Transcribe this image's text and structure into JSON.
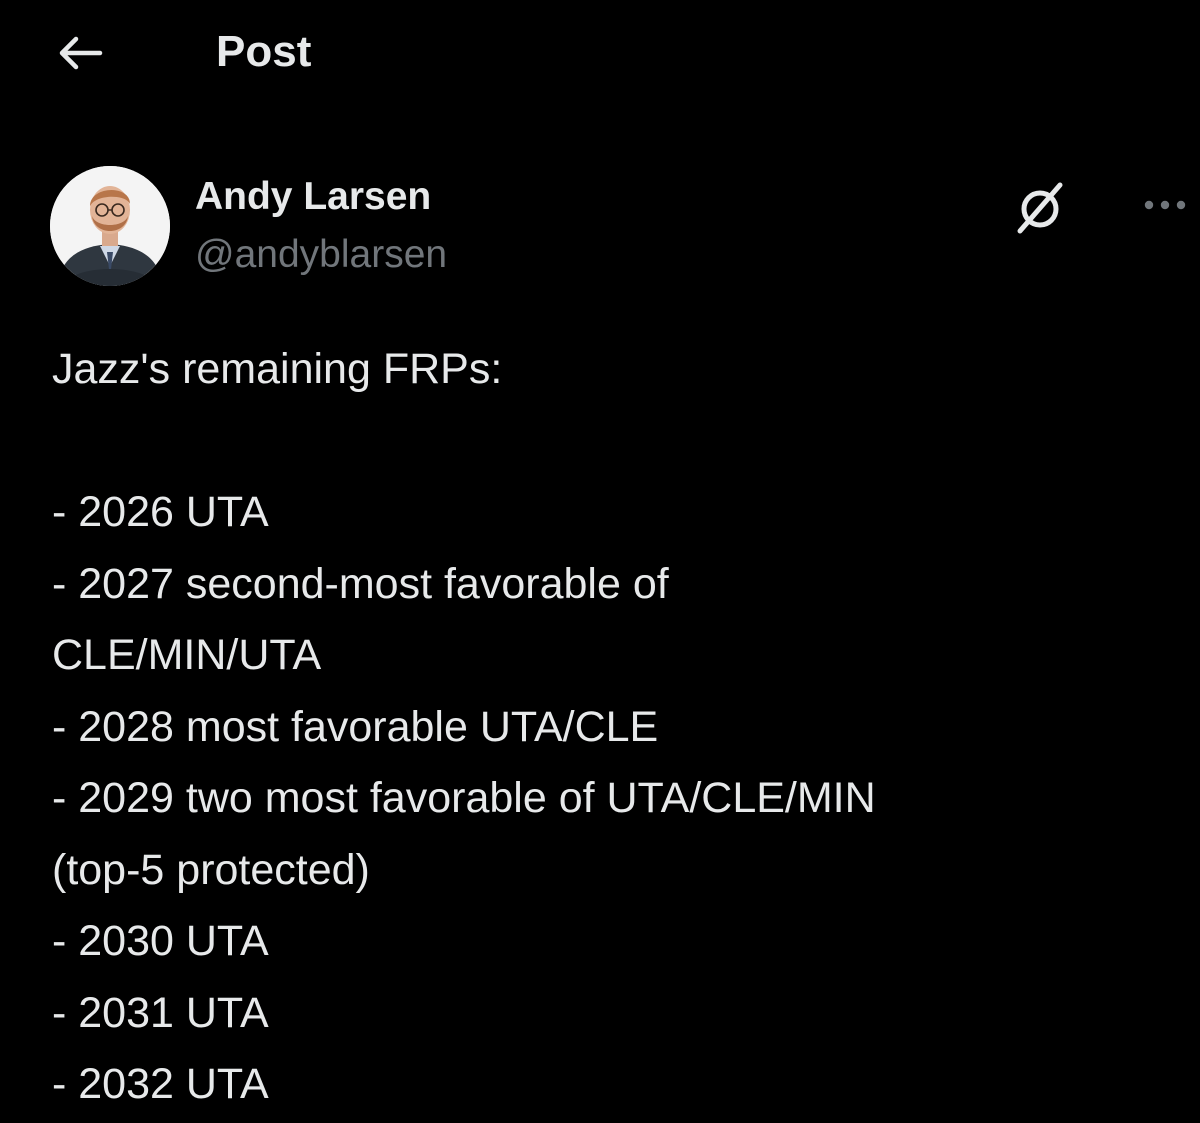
{
  "header": {
    "title": "Post",
    "back_icon": "arrow-left-icon"
  },
  "author": {
    "display_name": "Andy Larsen",
    "handle": "@andyblarsen",
    "avatar_icon": "avatar-photo",
    "actions": {
      "grok_icon": "grok-slash-icon",
      "more_icon": "more-dots-icon"
    }
  },
  "post": {
    "lines": [
      "Jazz's remaining FRPs:",
      "",
      "- 2026 UTA",
      "- 2027 second-most favorable of",
      "CLE/MIN/UTA",
      "- 2028 most favorable UTA/CLE",
      "- 2029 two most favorable of UTA/CLE/MIN",
      "(top-5 protected)",
      "- 2030 UTA",
      "- 2031 UTA",
      "- 2032 UTA"
    ]
  },
  "colors": {
    "background": "#000000",
    "primary_text": "#e7e9ea",
    "secondary_text": "#71767b"
  }
}
